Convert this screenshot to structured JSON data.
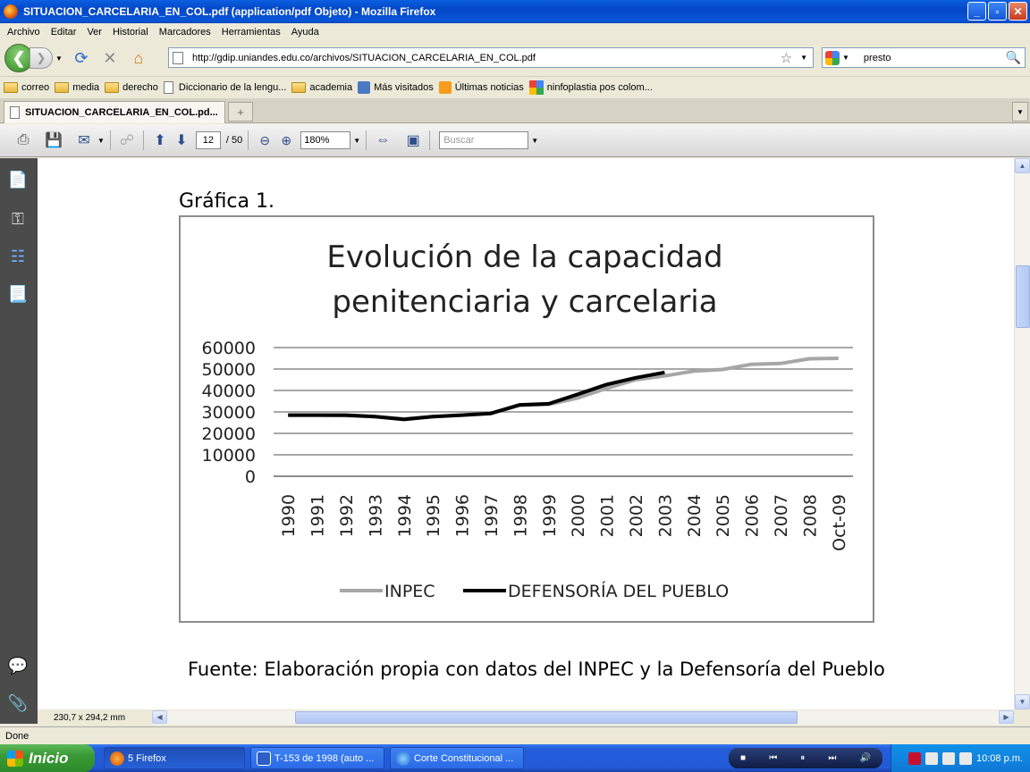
{
  "window": {
    "title": "SITUACION_CARCELARIA_EN_COL.pdf (application/pdf Objeto) - Mozilla Firefox",
    "buttons": {
      "minimize": "_",
      "maximize": "▫",
      "close": "✕"
    }
  },
  "menu": [
    "Archivo",
    "Editar",
    "Ver",
    "Historial",
    "Marcadores",
    "Herramientas",
    "Ayuda"
  ],
  "nav": {
    "url": "http://gdip.uniandes.edu.co/archivos/SITUACION_CARCELARIA_EN_COL.pdf",
    "search_value": "presto"
  },
  "bookmarks": [
    {
      "label": "correo",
      "icon": "folder-icon"
    },
    {
      "label": "media",
      "icon": "folder-icon"
    },
    {
      "label": "derecho",
      "icon": "folder-icon"
    },
    {
      "label": "Diccionario de la lengu...",
      "icon": "page-icon"
    },
    {
      "label": "academia",
      "icon": "folder-icon"
    },
    {
      "label": "Más visitados",
      "icon": "most-visited-icon"
    },
    {
      "label": "Últimas noticias",
      "icon": "rss-icon"
    },
    {
      "label": "ninfoplastia pos colom...",
      "icon": "google-icon"
    }
  ],
  "tabs": [
    {
      "label": "SITUACION_CARCELARIA_EN_COL.pd..."
    }
  ],
  "new_tab": "+",
  "pdf_toolbar": {
    "page_current": "12",
    "page_total": "/ 50",
    "zoom": "180%",
    "search_placeholder": "Buscar"
  },
  "document": {
    "figure_label": "Gráfica 1.",
    "source_note": "Fuente: Elaboración propia con datos del INPEC y la Defensoría del Pueblo",
    "page_size": "230,7 x 294,2 mm"
  },
  "chart_data": {
    "type": "line",
    "title_lines": [
      "Evolución de la capacidad",
      "penitenciaria y carcelaria"
    ],
    "categories": [
      "1990",
      "1991",
      "1992",
      "1993",
      "1994",
      "1995",
      "1996",
      "1997",
      "1998",
      "1999",
      "2000",
      "2001",
      "2002",
      "2003",
      "2004",
      "2005",
      "2006",
      "2007",
      "2008",
      "Oct-09"
    ],
    "yticks": [
      "60000",
      "50000",
      "40000",
      "30000",
      "20000",
      "10000",
      "0"
    ],
    "ylim": [
      0,
      60000
    ],
    "grid": true,
    "legend_placement": "bottom",
    "series": [
      {
        "name": "INPEC",
        "color": "#a6a6a6",
        "values": [
          28500,
          28500,
          28300,
          27800,
          26800,
          27800,
          28500,
          29400,
          33100,
          33500,
          36500,
          41000,
          45000,
          46800,
          49000,
          49800,
          52200,
          52600,
          54800,
          55000
        ]
      },
      {
        "name": "DEFENSORÍA DEL PUEBLO",
        "color": "#000000",
        "values": [
          28500,
          28500,
          28500,
          27800,
          26500,
          27800,
          28500,
          29300,
          33300,
          33800,
          38200,
          42800,
          45900,
          48400,
          null,
          null,
          null,
          null,
          null,
          null
        ]
      }
    ]
  },
  "status": {
    "text": "Done"
  },
  "taskbar": {
    "start": "Inicio",
    "items": [
      {
        "label": "5 Firefox",
        "icon": "firefox-icon"
      },
      {
        "label": "T-153 de 1998 (auto ...",
        "icon": "word-icon"
      },
      {
        "label": "Corte Constitucional ...",
        "icon": "ie-icon"
      }
    ],
    "clock": "10:08 p.m."
  },
  "colors": {
    "accent": "#0a56d8",
    "sidebar": "#4b4b4b",
    "taskbar": "#245edb"
  }
}
